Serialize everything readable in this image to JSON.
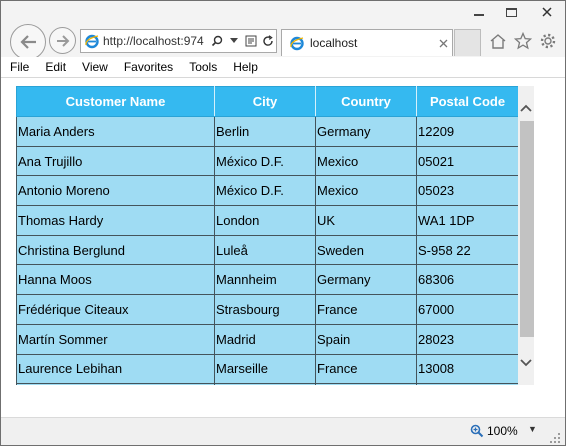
{
  "browser": {
    "address_url": "http://localhost:974",
    "tab_label": "localhost",
    "menu": [
      "File",
      "Edit",
      "View",
      "Favorites",
      "Tools",
      "Help"
    ],
    "zoom_label": "100%"
  },
  "grid": {
    "columns": [
      "Customer Name",
      "City",
      "Country",
      "Postal Code"
    ],
    "rows": [
      [
        "Maria Anders",
        "Berlin",
        "Germany",
        "12209"
      ],
      [
        "Ana Trujillo",
        "México D.F.",
        "Mexico",
        "05021"
      ],
      [
        "Antonio Moreno",
        "México D.F.",
        "Mexico",
        "05023"
      ],
      [
        "Thomas Hardy",
        "London",
        "UK",
        "WA1 1DP"
      ],
      [
        "Christina Berglund",
        "Luleå",
        "Sweden",
        "S-958 22"
      ],
      [
        "Hanna Moos",
        "Mannheim",
        "Germany",
        "68306"
      ],
      [
        "Frédérique Citeaux",
        "Strasbourg",
        "France",
        "67000"
      ],
      [
        "Martín Sommer",
        "Madrid",
        "Spain",
        "28023"
      ],
      [
        "Laurence Lebihan",
        "Marseille",
        "France",
        "13008"
      ],
      [
        "",
        "",
        "",
        ""
      ]
    ]
  },
  "icons": {
    "back": "back-arrow-icon",
    "forward": "forward-arrow-icon",
    "ie": "internet-explorer-icon",
    "search": "search-icon",
    "dropdown": "chevron-down-icon",
    "compat": "compatibility-view-icon",
    "refresh": "refresh-icon",
    "close_tab": "close-icon",
    "home": "home-icon",
    "favorites": "star-icon",
    "tools": "gear-icon",
    "zoom": "zoom-icon"
  },
  "colors": {
    "header_bg": "#35b9f0",
    "row_bg": "#9fdcf3",
    "accent_ie": "#1e88d8"
  }
}
